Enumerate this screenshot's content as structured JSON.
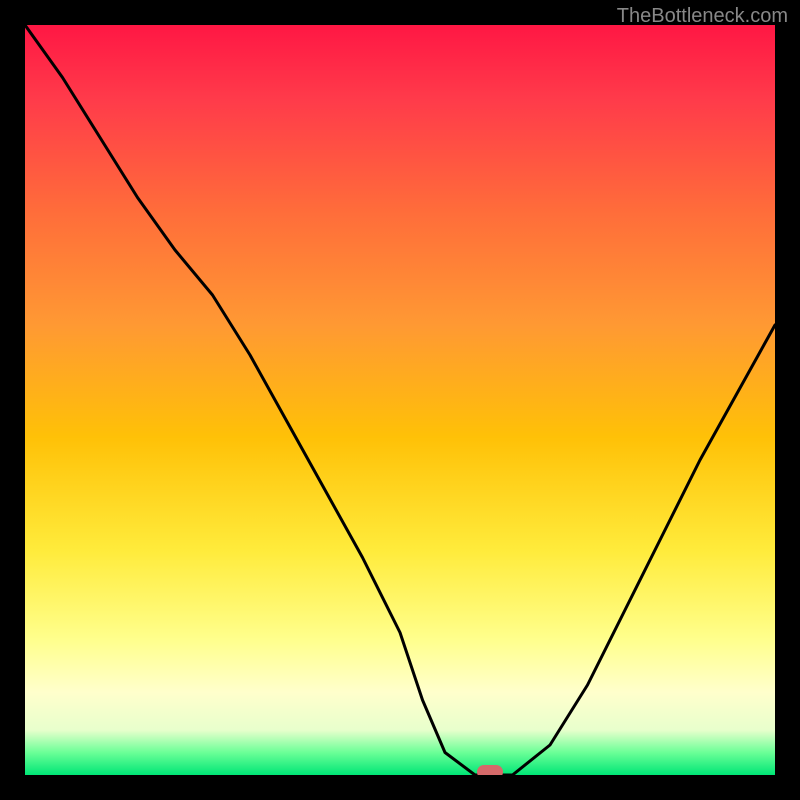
{
  "watermark": "TheBottleneck.com",
  "chart_data": {
    "type": "line",
    "title": "",
    "xlabel": "",
    "ylabel": "",
    "xlim": [
      0,
      100
    ],
    "ylim": [
      0,
      100
    ],
    "x": [
      0,
      5,
      10,
      15,
      20,
      25,
      30,
      35,
      40,
      45,
      50,
      53,
      56,
      60,
      65,
      70,
      75,
      80,
      85,
      90,
      95,
      100
    ],
    "y": [
      100,
      93,
      85,
      77,
      70,
      64,
      56,
      47,
      38,
      29,
      19,
      10,
      3,
      0,
      0,
      4,
      12,
      22,
      32,
      42,
      51,
      60
    ],
    "marker": {
      "x": 62,
      "y": 0
    },
    "background_gradient": [
      "#ff1744",
      "#ff9933",
      "#ffeb3b",
      "#ffffcc",
      "#00e676"
    ]
  }
}
